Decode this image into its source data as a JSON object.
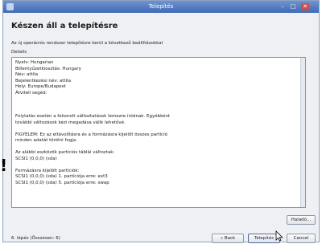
{
  "window": {
    "title": "Telepítés",
    "controls": [
      "–",
      "□",
      "✕"
    ]
  },
  "page": {
    "heading": "Készen áll a telepítésre",
    "subtitle": "Az új operációs rendszer telepítésre kerül a következő beállításokkal",
    "details_label": "Details",
    "side_mark": "!"
  },
  "details": {
    "summary": [
      "Nyelv: Hungarian",
      "Billentyűzetkiosztás: Hungary",
      "Név: attila",
      "Bejelentkezési név: attila",
      "Hely: Europe/Budapest",
      "Átviteli segéd:"
    ],
    "warning": [
      "Folytatás esetén a felsorolt változtatások lemezre íródnak. Egyébként",
      "további változások kézi megadása válik lehetővé."
    ],
    "caution": [
      "FIGYELEM: Ez az eltávolításra és a formázásra kijelölt összes partíció",
      "minden adatát törölni fogja."
    ],
    "tables": [
      "Az alábbi eszközök partíciós táblái változtak:",
      "SCSI1 (0,0,0) (sda)"
    ],
    "format": [
      "Formázásra kijelölt partíciók:",
      "SCSI1 (0,0,0) (sda) 1. partíciója erre: ext3",
      "SCSI1 (0,0,0) (sda) 5. partíciója erre: swap"
    ]
  },
  "buttons": {
    "advanced": "Haladó...",
    "back": "« Back",
    "install": "Telepítés",
    "cancel": "Cancel"
  },
  "footer": {
    "step": "6. lépés (Összesen: 6)"
  }
}
